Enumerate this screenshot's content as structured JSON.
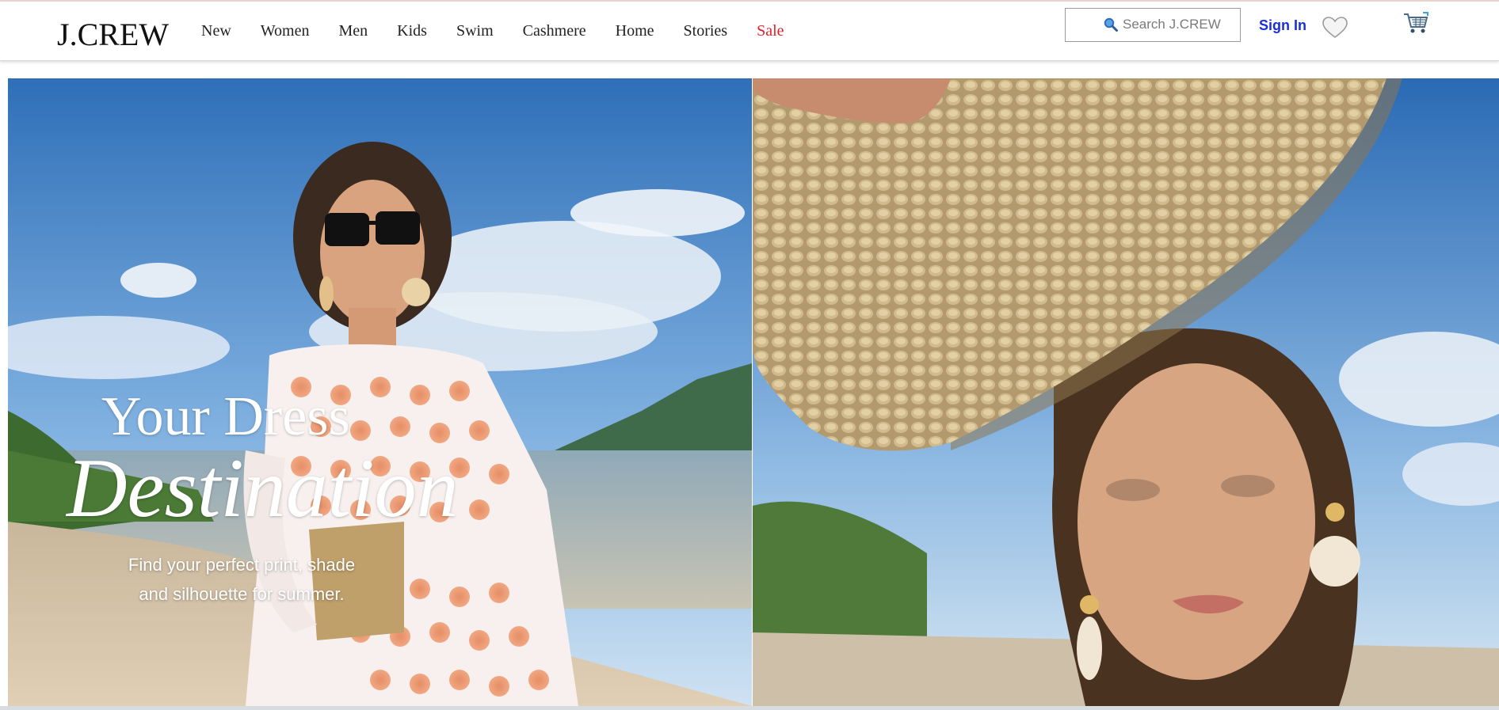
{
  "brand": {
    "logo": "J.CREW"
  },
  "nav": {
    "items": [
      {
        "label": "New"
      },
      {
        "label": "Women"
      },
      {
        "label": "Men"
      },
      {
        "label": "Kids"
      },
      {
        "label": "Swim"
      },
      {
        "label": "Cashmere"
      },
      {
        "label": "Home"
      },
      {
        "label": "Stories"
      },
      {
        "label": "Sale"
      }
    ]
  },
  "search": {
    "placeholder": "Search J.CREW",
    "value": ""
  },
  "account": {
    "signin_label": "Sign In"
  },
  "icons": {
    "wishlist": "heart-icon",
    "cart": "cart-icon",
    "search": "search-icon"
  },
  "colors": {
    "sale": "#e4202a",
    "signin": "#1a2fd6"
  },
  "hero": {
    "line1": "Your Dress",
    "line2": "Destination",
    "subtitle_line1": "Find your perfect print, shade",
    "subtitle_line2": "and silhouette for summer."
  }
}
